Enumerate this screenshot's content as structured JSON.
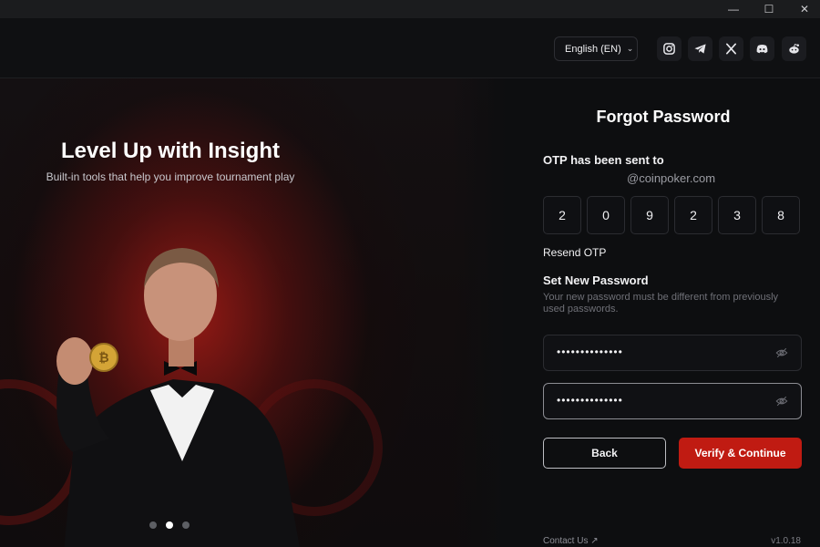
{
  "window": {
    "minimize": "—",
    "maximize": "☐",
    "close": "✕"
  },
  "header": {
    "language": "English (EN)",
    "socials": [
      "instagram-icon",
      "telegram-icon",
      "x-icon",
      "discord-icon",
      "reddit-icon"
    ]
  },
  "hero": {
    "title": "Level Up with Insight",
    "subtitle": "Built-in tools that help you improve tournament play",
    "carousel_count": 3,
    "carousel_active": 2
  },
  "form": {
    "title": "Forgot Password",
    "otp_label": "OTP has been sent to",
    "otp_email": "@coinpoker.com",
    "otp_digits": [
      "2",
      "0",
      "9",
      "2",
      "3",
      "8"
    ],
    "resend": "Resend OTP",
    "new_password_label": "Set New Password",
    "new_password_help": "Your new password must be different from previously used passwords.",
    "password_value": "••••••••••••••",
    "confirm_value": "••••••••••••••",
    "back_label": "Back",
    "verify_label": "Verify & Continue"
  },
  "footer": {
    "contact": "Contact Us ↗",
    "version": "v1.0.18"
  },
  "colors": {
    "accent": "#c01b12",
    "background": "#0d0e10"
  }
}
